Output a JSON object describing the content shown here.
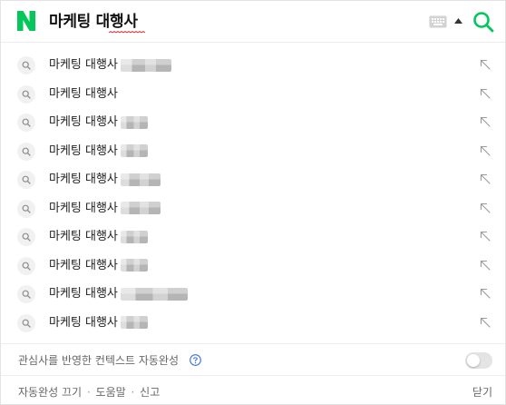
{
  "search": {
    "query": "마케팅 대행사",
    "icons": {
      "logo": "naver-n-logo",
      "keyboard": "keyboard-icon",
      "collapse": "arrow-up-icon",
      "submit": "search-icon"
    },
    "colors": {
      "brand": "#03c75a",
      "spellcheck": "#e02020"
    }
  },
  "suggestions": [
    {
      "prefix": "마케팅 대행사",
      "blurred": true
    },
    {
      "prefix": "마케팅 대행사",
      "blurred": false
    },
    {
      "prefix": "마케팅 대행사",
      "blurred": true
    },
    {
      "prefix": "마케팅 대행사",
      "blurred": true
    },
    {
      "prefix": "마케팅 대행사",
      "blurred": true
    },
    {
      "prefix": "마케팅 대행사",
      "blurred": true
    },
    {
      "prefix": "마케팅 대행사",
      "blurred": true
    },
    {
      "prefix": "마케팅 대행사",
      "blurred": true
    },
    {
      "prefix": "마케팅 대행사",
      "blurred": true
    },
    {
      "prefix": "마케팅 대행사",
      "blurred": true
    }
  ],
  "context": {
    "label": "관심사를 반영한 컨텍스트 자동완성",
    "enabled": false
  },
  "footer": {
    "autocomplete_off": "자동완성 끄기",
    "help": "도움말",
    "report": "신고",
    "separator": "·",
    "close": "닫기"
  }
}
